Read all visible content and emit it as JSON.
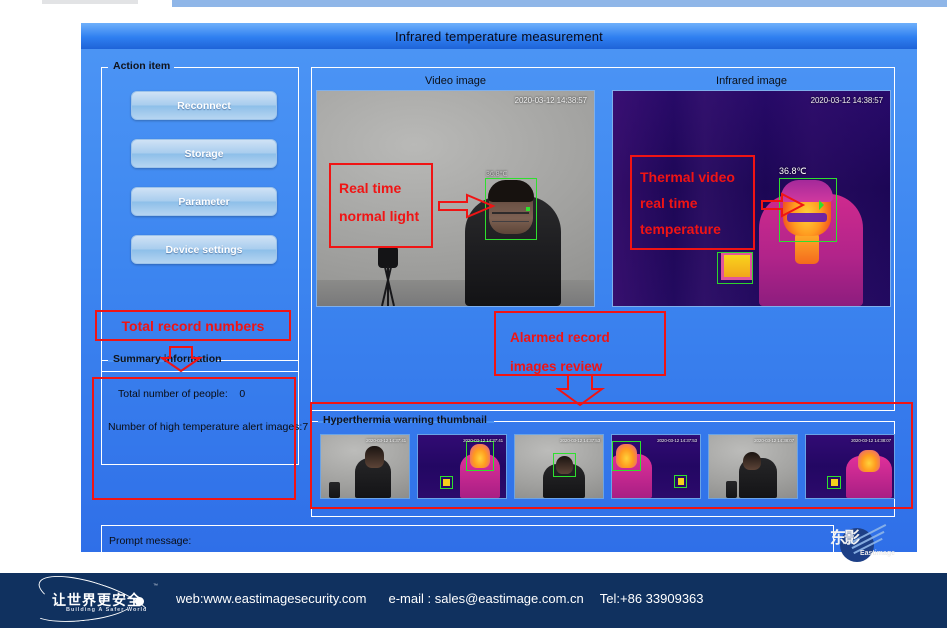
{
  "window": {
    "title": "Infrared temperature measurement"
  },
  "sidebar": {
    "action_group_label": "Action item",
    "buttons": [
      {
        "label": "Reconnect",
        "name": "reconnect-button"
      },
      {
        "label": "Storage",
        "name": "storage-button"
      },
      {
        "label": "Parameter",
        "name": "parameter-button"
      },
      {
        "label": "Device settings",
        "name": "device-settings-button"
      }
    ],
    "summary": {
      "group_label": "Summary information",
      "total_people_label": "Total number of people:",
      "total_people_value": "0",
      "high_temp_images_line": "Number of high temperature alert images:7"
    }
  },
  "display": {
    "video_label": "Video image",
    "infrared_label": "Infrared image",
    "video_timestamp": "2020-03-12 14:38:57",
    "infrared_timestamp": "2020-03-12 14:38:57",
    "infrared_face_temperature": "36.8℃",
    "video_face_temperature": "36.8℃"
  },
  "thumbnails": {
    "group_label": "Hyperthermia warning thumbnail",
    "items": [
      {
        "kind": "visible",
        "timestamp": "2020-03-12 14:37:41"
      },
      {
        "kind": "infrared",
        "timestamp": "2020-03-12 14:37:41"
      },
      {
        "kind": "visible",
        "timestamp": "2020-03-12 14:37:53"
      },
      {
        "kind": "infrared",
        "timestamp": "2020-03-12 14:37:53"
      },
      {
        "kind": "visible",
        "timestamp": "2020-03-12 14:38:07"
      },
      {
        "kind": "infrared",
        "timestamp": "2020-03-12 14:38:07"
      }
    ]
  },
  "prompt": {
    "label": "Prompt message:",
    "value": ""
  },
  "watermark": {
    "cjk": "东影",
    "word": "Eastimage"
  },
  "annotations": {
    "real_time_normal_light": {
      "line1": "Real time",
      "line2": "normal light"
    },
    "thermal_video": {
      "line1": "Thermal video",
      "line2": "real time",
      "line3": "temperature"
    },
    "total_record_numbers": "Total record numbers",
    "alarmed_record": {
      "line1": "Alarmed record",
      "line2": "images review"
    }
  },
  "footer": {
    "logo_cjk": "让世界更安全",
    "logo_sub": "Building A Safer World",
    "logo_tm": "™",
    "web": "web:www.eastimagesecurity.com",
    "email": "e-mail : sales@eastimage.com.cn",
    "tel": "Tel:+86 33909363"
  },
  "colors": {
    "window_blue": "#3d86f0",
    "title_blue": "#2f7ff0",
    "annotation_red": "#f01414",
    "footer_navy": "#10315f",
    "face_box_green": "#2ee02e"
  }
}
